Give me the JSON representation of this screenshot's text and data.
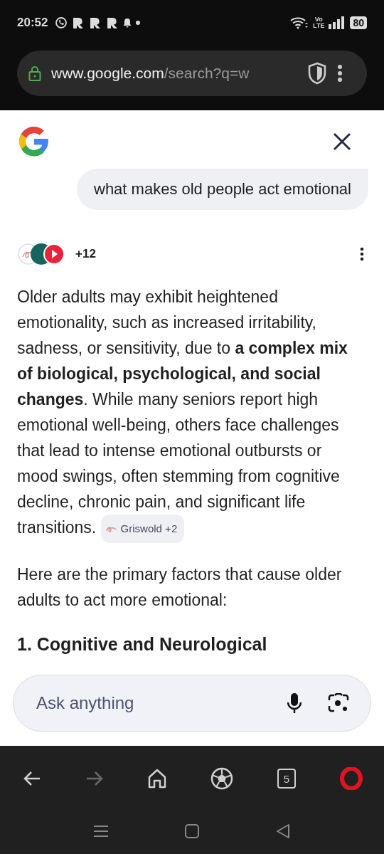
{
  "status_bar": {
    "time": "20:52",
    "network": [
      "Vo",
      "LTE"
    ],
    "battery": "80"
  },
  "address_bar": {
    "host": "www.google.com",
    "path": "/search?q=w"
  },
  "query": "what makes old people act emotional",
  "sources": {
    "count": "+12"
  },
  "answer": {
    "paragraphs": [
      "Older adults may exhibit heightened emotionality, such as increased irritability, sadness, or sensitivity, due to **a complex mix of biological, psychological, and social changes**. While many seniors report high emotional well-being, others face challenges that lead to intense emotional outbursts or mood swings, often stemming from cognitive decline, chronic pain, and significant life transitions.",
      "Here are the primary factors that cause older adults to act more emotional:"
    ],
    "citation": "Griswold +2",
    "heading": "1. Cognitive and Neurological"
  },
  "ask_box": {
    "placeholder": "Ask anything"
  },
  "toolbar": [
    {
      "kind": "back",
      "disabled": false
    },
    {
      "kind": "forward",
      "disabled": true
    },
    {
      "kind": "home",
      "disabled": false
    },
    {
      "kind": "ball",
      "disabled": false
    },
    {
      "kind": "tabs",
      "disabled": false,
      "count": "5"
    },
    {
      "kind": "opera",
      "disabled": false
    }
  ]
}
